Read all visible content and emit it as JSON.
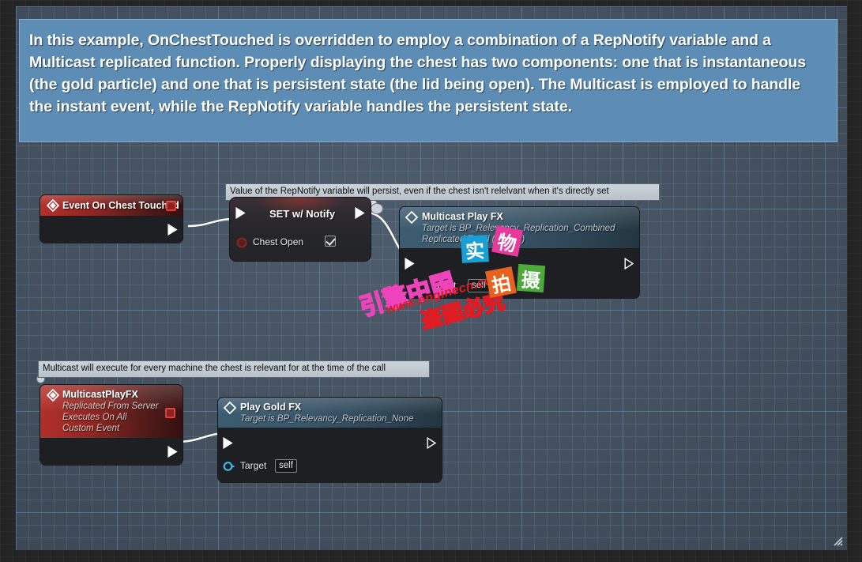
{
  "comment_banner": {
    "text": "In this example, OnChestTouched is overridden to employ a combination of a RepNotify variable and a Multicast replicated function. Properly displaying the chest has two components: one that is instantaneous (the gold particle) and one that is persistent state (the lid being open). The Multicast is employed to handle the instant event, while the RepNotify variable handles the persistent state.",
    "fill_color": "#5d8cb4",
    "border_color": "#87abc9"
  },
  "tooltips": {
    "repnotify_persist": "Value of the RepNotify variable will persist, even if the chest isn't relelvant when it's directly set",
    "multicast_relevant": "Multicast will execute for every machine the chest is relevant for at the time of the call"
  },
  "nodes": {
    "event_on_chest_touched": {
      "title": "Event On Chest Touched",
      "icon": "event-diamond-icon",
      "delegate_pin": "red-square-pin",
      "exec_out": "exec-out-pin",
      "header_color": "#b5302b"
    },
    "set_with_notify": {
      "title": "SET w/ Notify",
      "exec_in": "exec-in-pin",
      "exec_out": "exec-out-pin",
      "property_label": "Chest Open",
      "property_value": "checked",
      "property_pin": "bool-red-pin"
    },
    "multicast_play_fx": {
      "title": "Multicast Play FX",
      "subtitle_1": "Target is BP_Relevancy_Replication_Combined",
      "subtitle_2": "Replicated To All (Server)",
      "icon": "function-diamond-icon",
      "exec_in": "exec-in-pin",
      "exec_out": "exec-out-pin",
      "target_label": "Target",
      "target_value": "self",
      "header_color": "#3d5c70"
    },
    "multicast_play_fx_event": {
      "title": "MulticastPlayFX",
      "subtitle_1": "Replicated From Server",
      "subtitle_2": "Executes On All",
      "subtitle_3": "Custom Event",
      "icon": "event-diamond-icon",
      "delegate_pin": "red-square-pin",
      "exec_out": "exec-out-pin",
      "header_color": "#b5302b"
    },
    "play_gold_fx": {
      "title": "Play Gold FX",
      "subtitle_1": "Target is BP_Relevancy_Replication_None",
      "icon": "function-diamond-icon",
      "exec_in": "exec-in-pin",
      "exec_out": "exec-out-pin",
      "target_label": "Target",
      "target_value": "self",
      "header_color": "#3d5c70"
    }
  },
  "watermarks": {
    "brand_cn": "引擎中国",
    "url": "www.enginecn.com",
    "warning_cn": "盗图必究",
    "stickers": [
      {
        "char": "实",
        "color": "#1a9fd4"
      },
      {
        "char": "物",
        "color": "#e8389c"
      },
      {
        "char": "拍",
        "color": "#e8611e"
      },
      {
        "char": "摄",
        "color": "#4ca93a"
      }
    ]
  },
  "canvas": {
    "grid_base_color": "#4a5764",
    "resize_grip": "resize-grip-icon"
  }
}
